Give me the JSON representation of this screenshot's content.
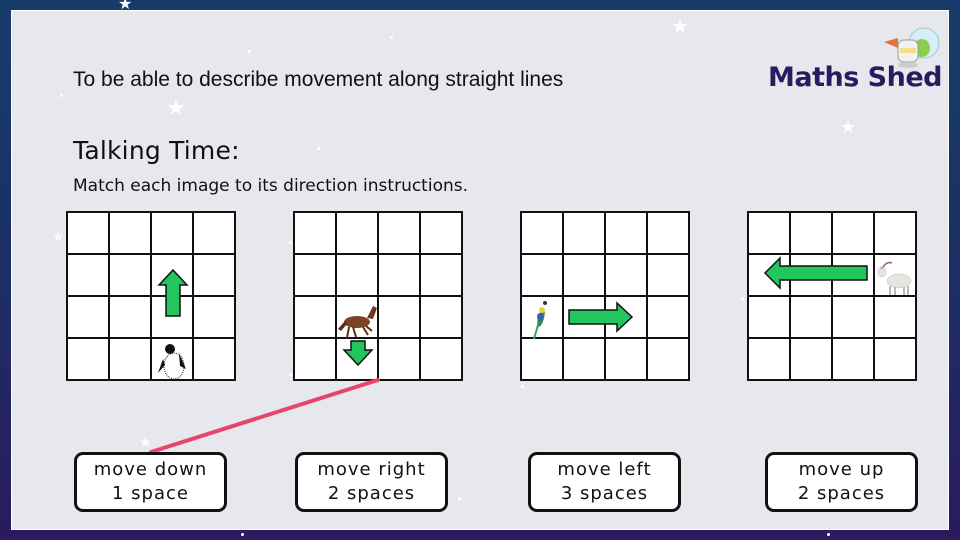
{
  "slide": {
    "objective": "To be able to describe movement along straight lines",
    "heading": "Talking Time:",
    "instruction": "Match each image to its direction instructions.",
    "logo": "Maths Shed"
  },
  "grids": [
    {
      "animal": "penguin",
      "animal_cell": {
        "row": 4,
        "col": 3
      },
      "arrow": {
        "direction": "up",
        "cells": 2
      }
    },
    {
      "animal": "horse",
      "animal_cell": {
        "row": 3,
        "col": 2
      },
      "arrow": {
        "direction": "down",
        "cells": 1
      }
    },
    {
      "animal": "parrot",
      "animal_cell": {
        "row": 3,
        "col": 1
      },
      "arrow": {
        "direction": "right",
        "cells": 2
      }
    },
    {
      "animal": "goat",
      "animal_cell": {
        "row": 2,
        "col": 4
      },
      "arrow": {
        "direction": "left",
        "cells": 3
      }
    }
  ],
  "answers": [
    {
      "line1": "move down",
      "line2": "1 space"
    },
    {
      "line1": "move right",
      "line2": "2 spaces"
    },
    {
      "line1": "move left",
      "line2": "3 spaces"
    },
    {
      "line1": "move up",
      "line2": "2 spaces"
    }
  ],
  "connections": [
    {
      "from_grid": "horse",
      "to_answer": "move down 1 space"
    }
  ],
  "colors": {
    "arrow_fill": "#22c55e",
    "connector": "#e8456a",
    "logo": "#2a1a5e",
    "slide_bg": "#e6e8ee"
  }
}
